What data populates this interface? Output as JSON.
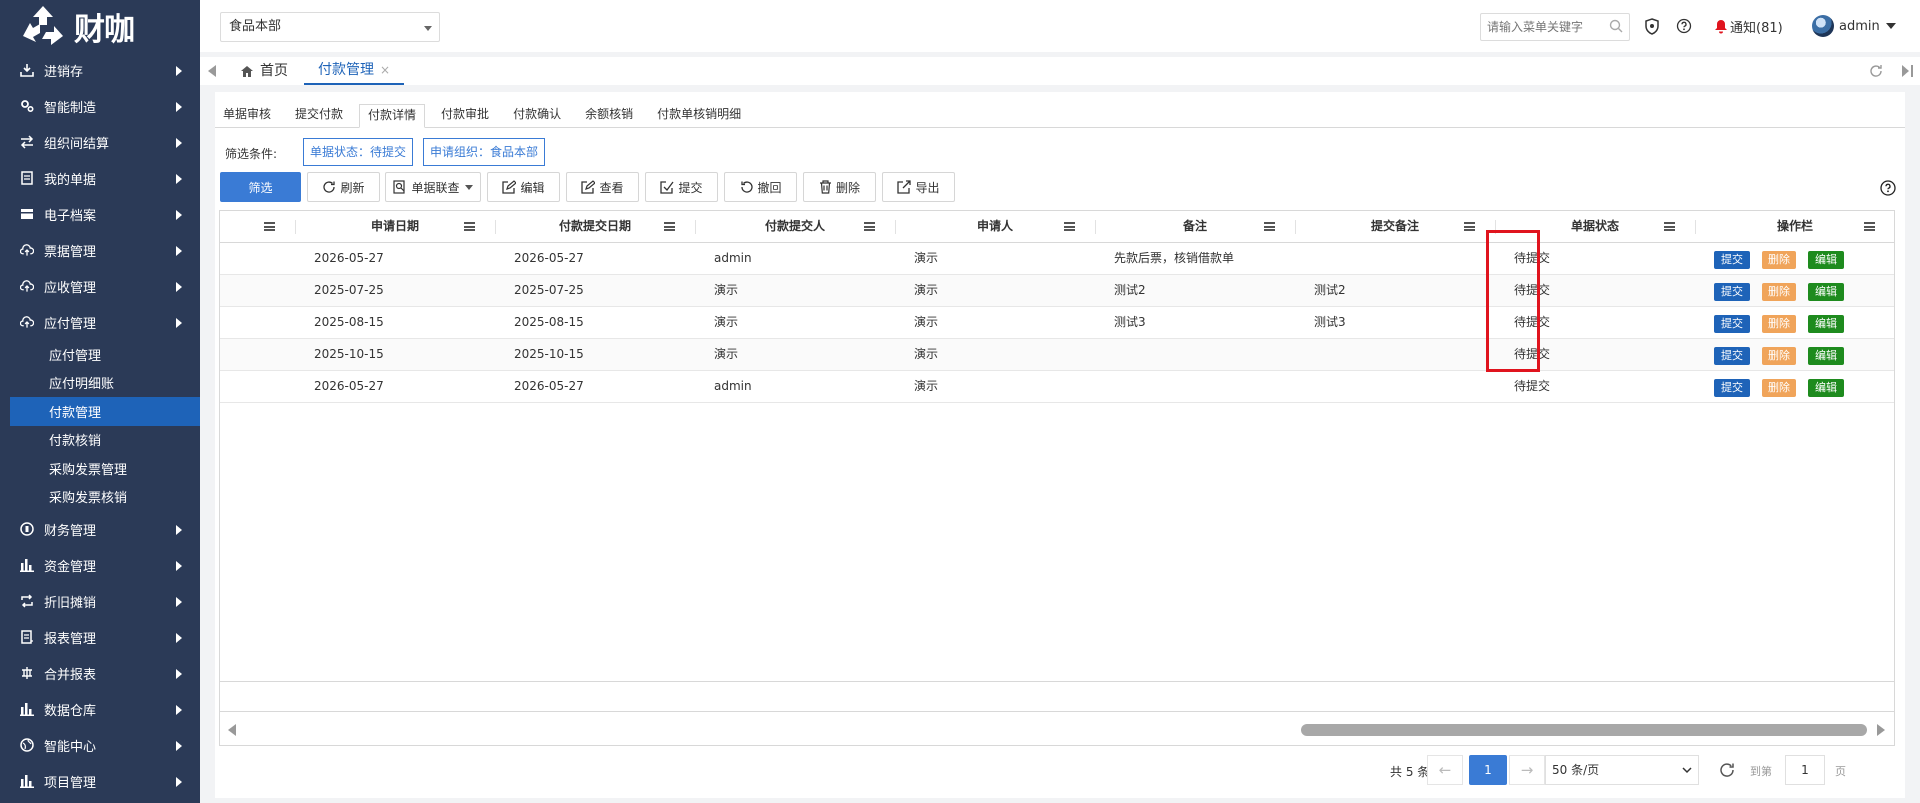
{
  "app": {
    "name": "财咖",
    "org_select": "食品本部",
    "search_placeholder": "请输入菜单关键字",
    "notice": "通知(81)",
    "user": "admin"
  },
  "sidebar": {
    "items": [
      {
        "label": "进销存",
        "icon": "download-icon"
      },
      {
        "label": "智能制造",
        "icon": "gears-icon"
      },
      {
        "label": "组织间结算",
        "icon": "transfer-icon"
      },
      {
        "label": "我的单据",
        "icon": "document-icon"
      },
      {
        "label": "电子档案",
        "icon": "archive-icon"
      },
      {
        "label": "票据管理",
        "icon": "cloud-upload-icon"
      },
      {
        "label": "应收管理",
        "icon": "cloud-upload-icon"
      },
      {
        "label": "应付管理",
        "icon": "cloud-upload-icon"
      }
    ],
    "sub_items": [
      "应付管理",
      "应付明细账",
      "付款管理",
      "付款核销",
      "采购发票管理",
      "采购发票核销"
    ],
    "active_sub": "付款管理",
    "items_after": [
      {
        "label": "财务管理",
        "icon": "coin-icon"
      },
      {
        "label": "资金管理",
        "icon": "bar-chart-icon"
      },
      {
        "label": "折旧摊销",
        "icon": "cycle-icon"
      },
      {
        "label": "报表管理",
        "icon": "report-icon"
      },
      {
        "label": "合并报表",
        "icon": "merge-icon"
      },
      {
        "label": "数据仓库",
        "icon": "bar-chart-icon"
      },
      {
        "label": "智能中心",
        "icon": "globe-icon"
      },
      {
        "label": "项目管理",
        "icon": "bar-chart-icon"
      }
    ]
  },
  "tabs": {
    "home": "首页",
    "current": "付款管理",
    "close": "×"
  },
  "subtabs": [
    "单据审核",
    "提交付款",
    "付款详情",
    "付款审批",
    "付款确认",
    "余额核销",
    "付款单核销明细"
  ],
  "active_subtab": "付款详情",
  "filter": {
    "label": "筛选条件:",
    "chips": [
      "单据状态：待提交",
      "申请组织：食品本部"
    ]
  },
  "toolbar": {
    "filter": "筛选",
    "refresh": "刷新",
    "linked": "单据联查",
    "edit": "编辑",
    "view": "查看",
    "submit": "提交",
    "withdraw": "撤回",
    "delete": "删除",
    "export": "导出"
  },
  "table": {
    "columns": [
      "申请日期",
      "付款提交日期",
      "付款提交人",
      "申请人",
      "备注",
      "提交备注",
      "单据状态",
      "操作栏"
    ],
    "rows": [
      [
        "2026-05-27",
        "2026-05-27",
        "admin",
        "演示",
        "先款后票，核销借款单",
        "",
        "待提交"
      ],
      [
        "2025-07-25",
        "2025-07-25",
        "演示",
        "演示",
        "测试2",
        "测试2",
        "待提交"
      ],
      [
        "2025-08-15",
        "2025-08-15",
        "演示",
        "演示",
        "测试3",
        "测试3",
        "待提交"
      ],
      [
        "2025-10-15",
        "2025-10-15",
        "演示",
        "演示",
        "",
        "",
        "待提交"
      ],
      [
        "2026-05-27",
        "2026-05-27",
        "admin",
        "演示",
        "",
        "",
        "待提交"
      ]
    ],
    "actions": {
      "submit": "提交",
      "delete": "删除",
      "edit": "编辑"
    }
  },
  "pager": {
    "total": "共 5 条",
    "prev": "←",
    "next": "→",
    "current": "1",
    "page_size": "50 条/页",
    "goto": "到第",
    "page_input": "1",
    "unit": "页"
  },
  "colors": {
    "sidebar_bg": "#2b3a57",
    "active": "#1e63b8",
    "primary": "#3a7bd5",
    "delete": "#f0a45a",
    "edit": "#1e8b1e",
    "highlight": "#e0141e"
  }
}
